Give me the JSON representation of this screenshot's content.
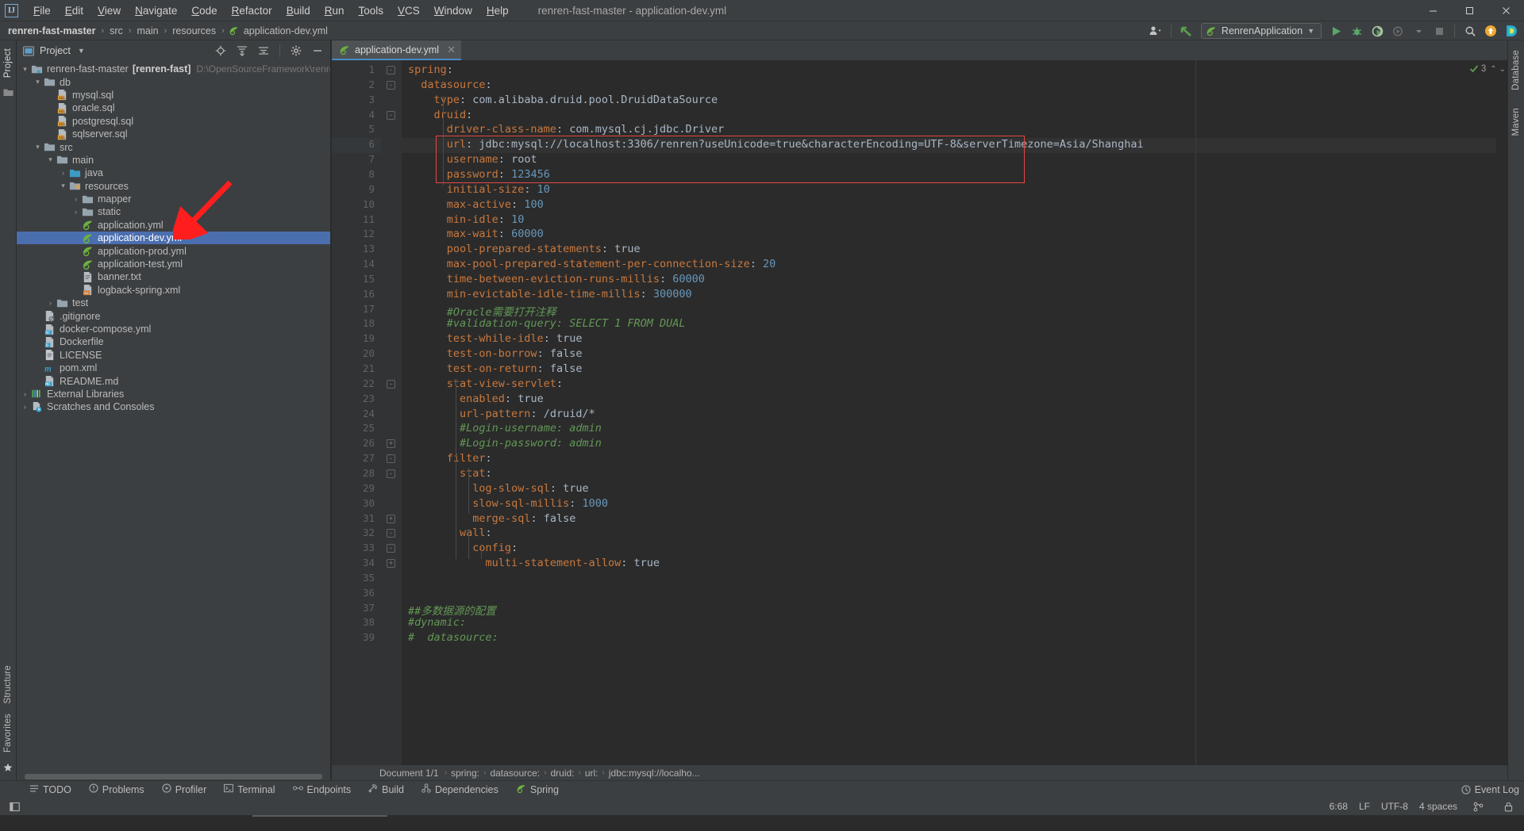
{
  "window": {
    "title": "renren-fast-master - application-dev.yml",
    "logo": "IJ",
    "minimize": "—",
    "maximize": "⬜",
    "close": "✕"
  },
  "menu": {
    "items": [
      "File",
      "Edit",
      "View",
      "Navigate",
      "Code",
      "Refactor",
      "Build",
      "Run",
      "Tools",
      "VCS",
      "Window",
      "Help"
    ]
  },
  "navbar": {
    "crumbs": [
      "renren-fast-master",
      "src",
      "main",
      "resources",
      "application-dev.yml"
    ],
    "separator": "›",
    "run_config": "RenrenApplication",
    "icons": {
      "profile": "profile-icon",
      "updates": "update-arrow-icon",
      "run": "run-icon",
      "debug": "debug-icon",
      "run_coverage": "run-with-coverage-icon",
      "profiler": "profiler-icon",
      "stop": "stop-icon",
      "search": "search-everywhere-icon",
      "notifications": "notification-icon",
      "idea_feature": "idea-feature-icon"
    }
  },
  "left_strip": {
    "project": "Project",
    "structure": "Structure",
    "favorites": "Favorites"
  },
  "right_strip": {
    "database": "Database",
    "maven": "Maven"
  },
  "project_panel": {
    "title": "Project",
    "chevron": "▾",
    "icons": [
      "locate-icon",
      "expand-all-icon",
      "collapse-all-icon",
      "settings-gear-icon",
      "hide-icon"
    ],
    "tree": [
      {
        "depth": 0,
        "arrow": "▾",
        "icon": "module-folder",
        "label": "renren-fast-master",
        "module": "[renren-fast]",
        "path": "D:\\OpenSourceFramework\\renren-fast-m",
        "selected": false
      },
      {
        "depth": 1,
        "arrow": "▾",
        "icon": "folder",
        "label": "db",
        "selected": false
      },
      {
        "depth": 2,
        "arrow": "",
        "icon": "sql-file",
        "label": "mysql.sql",
        "selected": false
      },
      {
        "depth": 2,
        "arrow": "",
        "icon": "sql-file",
        "label": "oracle.sql",
        "selected": false
      },
      {
        "depth": 2,
        "arrow": "",
        "icon": "sql-file",
        "label": "postgresql.sql",
        "selected": false
      },
      {
        "depth": 2,
        "arrow": "",
        "icon": "sql-file",
        "label": "sqlserver.sql",
        "selected": false
      },
      {
        "depth": 1,
        "arrow": "▾",
        "icon": "folder",
        "label": "src",
        "selected": false
      },
      {
        "depth": 2,
        "arrow": "▾",
        "icon": "folder",
        "label": "main",
        "selected": false
      },
      {
        "depth": 3,
        "arrow": "›",
        "icon": "source-folder",
        "label": "java",
        "selected": false
      },
      {
        "depth": 3,
        "arrow": "▾",
        "icon": "resource-folder",
        "label": "resources",
        "selected": false
      },
      {
        "depth": 4,
        "arrow": "›",
        "icon": "folder",
        "label": "mapper",
        "selected": false
      },
      {
        "depth": 4,
        "arrow": "›",
        "icon": "folder",
        "label": "static",
        "selected": false
      },
      {
        "depth": 4,
        "arrow": "",
        "icon": "spring-yaml-file",
        "label": "application.yml",
        "selected": false
      },
      {
        "depth": 4,
        "arrow": "",
        "icon": "spring-yaml-file",
        "label": "application-dev.yml",
        "selected": true
      },
      {
        "depth": 4,
        "arrow": "",
        "icon": "spring-yaml-file",
        "label": "application-prod.yml",
        "selected": false
      },
      {
        "depth": 4,
        "arrow": "",
        "icon": "spring-yaml-file",
        "label": "application-test.yml",
        "selected": false
      },
      {
        "depth": 4,
        "arrow": "",
        "icon": "text-file",
        "label": "banner.txt",
        "selected": false
      },
      {
        "depth": 4,
        "arrow": "",
        "icon": "xml-file",
        "label": "logback-spring.xml",
        "selected": false
      },
      {
        "depth": 2,
        "arrow": "›",
        "icon": "folder",
        "label": "test",
        "selected": false
      },
      {
        "depth": 1,
        "arrow": "",
        "icon": "gitignore-file",
        "label": ".gitignore",
        "selected": false
      },
      {
        "depth": 1,
        "arrow": "",
        "icon": "docker-compose-file",
        "label": "docker-compose.yml",
        "selected": false
      },
      {
        "depth": 1,
        "arrow": "",
        "icon": "docker-file",
        "label": "Dockerfile",
        "selected": false
      },
      {
        "depth": 1,
        "arrow": "",
        "icon": "license-file",
        "label": "LICENSE",
        "selected": false
      },
      {
        "depth": 1,
        "arrow": "",
        "icon": "maven-file",
        "label": "pom.xml",
        "selected": false
      },
      {
        "depth": 1,
        "arrow": "",
        "icon": "markdown-file",
        "label": "README.md",
        "selected": false
      },
      {
        "depth": 0,
        "arrow": "›",
        "icon": "libraries-icon",
        "label": "External Libraries",
        "selected": false
      },
      {
        "depth": 0,
        "arrow": "›",
        "icon": "scratches-icon",
        "label": "Scratches and Consoles",
        "selected": false
      }
    ]
  },
  "editor": {
    "tab": {
      "label": "application-dev.yml",
      "icon": "spring-yaml-file",
      "close": "✕"
    },
    "inspection": {
      "ok_icon": "✓",
      "count": "3",
      "up": "⌃",
      "down": "⌄"
    },
    "lines": [
      {
        "n": 1,
        "indent": 0,
        "fold": "-",
        "spans": [
          {
            "t": "spring",
            "c": "k"
          },
          {
            "t": ":",
            "c": "p"
          }
        ]
      },
      {
        "n": 2,
        "indent": 2,
        "fold": "-",
        "spans": [
          {
            "t": "datasource",
            "c": "k"
          },
          {
            "t": ":",
            "c": "p"
          }
        ]
      },
      {
        "n": 3,
        "indent": 4,
        "fold": "",
        "spans": [
          {
            "t": "type",
            "c": "k"
          },
          {
            "t": ": ",
            "c": "p"
          },
          {
            "t": "com.alibaba.druid.pool.DruidDataSource",
            "c": "v"
          }
        ]
      },
      {
        "n": 4,
        "indent": 4,
        "fold": "-",
        "spans": [
          {
            "t": "druid",
            "c": "k"
          },
          {
            "t": ":",
            "c": "p"
          }
        ]
      },
      {
        "n": 5,
        "indent": 6,
        "fold": "",
        "spans": [
          {
            "t": "driver-class-name",
            "c": "k"
          },
          {
            "t": ": ",
            "c": "p"
          },
          {
            "t": "com.mysql.cj.jdbc.Driver",
            "c": "v"
          }
        ]
      },
      {
        "n": 6,
        "indent": 6,
        "fold": "",
        "spans": [
          {
            "t": "url",
            "c": "k"
          },
          {
            "t": ": ",
            "c": "p"
          },
          {
            "t": "jdbc:mysql://localhost:3306/renren?useUnicode=true&characterEncoding=UTF-8&serverTimezone=Asia/Shanghai",
            "c": "v"
          }
        ]
      },
      {
        "n": 7,
        "indent": 6,
        "fold": "",
        "spans": [
          {
            "t": "username",
            "c": "k"
          },
          {
            "t": ": ",
            "c": "p"
          },
          {
            "t": "root",
            "c": "v"
          }
        ]
      },
      {
        "n": 8,
        "indent": 6,
        "fold": "",
        "spans": [
          {
            "t": "password",
            "c": "k"
          },
          {
            "t": ": ",
            "c": "p"
          },
          {
            "t": "123456",
            "c": "n"
          }
        ]
      },
      {
        "n": 9,
        "indent": 6,
        "fold": "",
        "spans": [
          {
            "t": "initial-size",
            "c": "k"
          },
          {
            "t": ": ",
            "c": "p"
          },
          {
            "t": "10",
            "c": "n"
          }
        ]
      },
      {
        "n": 10,
        "indent": 6,
        "fold": "",
        "spans": [
          {
            "t": "max-active",
            "c": "k"
          },
          {
            "t": ": ",
            "c": "p"
          },
          {
            "t": "100",
            "c": "n"
          }
        ]
      },
      {
        "n": 11,
        "indent": 6,
        "fold": "",
        "spans": [
          {
            "t": "min-idle",
            "c": "k"
          },
          {
            "t": ": ",
            "c": "p"
          },
          {
            "t": "10",
            "c": "n"
          }
        ]
      },
      {
        "n": 12,
        "indent": 6,
        "fold": "",
        "spans": [
          {
            "t": "max-wait",
            "c": "k"
          },
          {
            "t": ": ",
            "c": "p"
          },
          {
            "t": "60000",
            "c": "n"
          }
        ]
      },
      {
        "n": 13,
        "indent": 6,
        "fold": "",
        "spans": [
          {
            "t": "pool-prepared-statements",
            "c": "k"
          },
          {
            "t": ": ",
            "c": "p"
          },
          {
            "t": "true",
            "c": "v"
          }
        ]
      },
      {
        "n": 14,
        "indent": 6,
        "fold": "",
        "spans": [
          {
            "t": "max-pool-prepared-statement-per-connection-size",
            "c": "k"
          },
          {
            "t": ": ",
            "c": "p"
          },
          {
            "t": "20",
            "c": "n"
          }
        ]
      },
      {
        "n": 15,
        "indent": 6,
        "fold": "",
        "spans": [
          {
            "t": "time-between-eviction-runs-millis",
            "c": "k"
          },
          {
            "t": ": ",
            "c": "p"
          },
          {
            "t": "60000",
            "c": "n"
          }
        ]
      },
      {
        "n": 16,
        "indent": 6,
        "fold": "",
        "spans": [
          {
            "t": "min-evictable-idle-time-millis",
            "c": "k"
          },
          {
            "t": ": ",
            "c": "p"
          },
          {
            "t": "300000",
            "c": "n"
          }
        ]
      },
      {
        "n": 17,
        "indent": 6,
        "fold": "",
        "spans": [
          {
            "t": "#Oracle需要打开注释",
            "c": "cmt"
          }
        ]
      },
      {
        "n": 18,
        "indent": 6,
        "fold": "",
        "spans": [
          {
            "t": "#validation-query: SELECT 1 FROM DUAL",
            "c": "cmt"
          }
        ]
      },
      {
        "n": 19,
        "indent": 6,
        "fold": "",
        "spans": [
          {
            "t": "test-while-idle",
            "c": "k"
          },
          {
            "t": ": ",
            "c": "p"
          },
          {
            "t": "true",
            "c": "v"
          }
        ]
      },
      {
        "n": 20,
        "indent": 6,
        "fold": "",
        "spans": [
          {
            "t": "test-on-borrow",
            "c": "k"
          },
          {
            "t": ": ",
            "c": "p"
          },
          {
            "t": "false",
            "c": "v"
          }
        ]
      },
      {
        "n": 21,
        "indent": 6,
        "fold": "",
        "spans": [
          {
            "t": "test-on-return",
            "c": "k"
          },
          {
            "t": ": ",
            "c": "p"
          },
          {
            "t": "false",
            "c": "v"
          }
        ]
      },
      {
        "n": 22,
        "indent": 6,
        "fold": "-",
        "spans": [
          {
            "t": "stat-view-servlet",
            "c": "k"
          },
          {
            "t": ":",
            "c": "p"
          }
        ]
      },
      {
        "n": 23,
        "indent": 8,
        "fold": "",
        "spans": [
          {
            "t": "enabled",
            "c": "k"
          },
          {
            "t": ": ",
            "c": "p"
          },
          {
            "t": "true",
            "c": "v"
          }
        ]
      },
      {
        "n": 24,
        "indent": 8,
        "fold": "",
        "spans": [
          {
            "t": "url-pattern",
            "c": "k"
          },
          {
            "t": ": ",
            "c": "p"
          },
          {
            "t": "/druid/*",
            "c": "v"
          }
        ]
      },
      {
        "n": 25,
        "indent": 8,
        "fold": "",
        "spans": [
          {
            "t": "#Login-username: admin",
            "c": "cmt"
          }
        ]
      },
      {
        "n": 26,
        "indent": 8,
        "fold": "+",
        "spans": [
          {
            "t": "#Login-password: admin",
            "c": "cmt"
          }
        ]
      },
      {
        "n": 27,
        "indent": 6,
        "fold": "-",
        "spans": [
          {
            "t": "filter",
            "c": "k"
          },
          {
            "t": ":",
            "c": "p"
          }
        ]
      },
      {
        "n": 28,
        "indent": 8,
        "fold": "-",
        "spans": [
          {
            "t": "stat",
            "c": "k"
          },
          {
            "t": ":",
            "c": "p"
          }
        ]
      },
      {
        "n": 29,
        "indent": 10,
        "fold": "",
        "spans": [
          {
            "t": "log-slow-sql",
            "c": "k"
          },
          {
            "t": ": ",
            "c": "p"
          },
          {
            "t": "true",
            "c": "v"
          }
        ]
      },
      {
        "n": 30,
        "indent": 10,
        "fold": "",
        "spans": [
          {
            "t": "slow-sql-millis",
            "c": "k"
          },
          {
            "t": ": ",
            "c": "p"
          },
          {
            "t": "1000",
            "c": "n"
          }
        ]
      },
      {
        "n": 31,
        "indent": 10,
        "fold": "+",
        "spans": [
          {
            "t": "merge-sql",
            "c": "k"
          },
          {
            "t": ": ",
            "c": "p"
          },
          {
            "t": "false",
            "c": "v"
          }
        ]
      },
      {
        "n": 32,
        "indent": 8,
        "fold": "-",
        "spans": [
          {
            "t": "wall",
            "c": "k"
          },
          {
            "t": ":",
            "c": "p"
          }
        ]
      },
      {
        "n": 33,
        "indent": 10,
        "fold": "-",
        "spans": [
          {
            "t": "config",
            "c": "k"
          },
          {
            "t": ":",
            "c": "p"
          }
        ]
      },
      {
        "n": 34,
        "indent": 12,
        "fold": "+",
        "spans": [
          {
            "t": "multi-statement-allow",
            "c": "k"
          },
          {
            "t": ": ",
            "c": "p"
          },
          {
            "t": "true",
            "c": "v"
          }
        ]
      },
      {
        "n": 35,
        "indent": 0,
        "fold": "",
        "spans": []
      },
      {
        "n": 36,
        "indent": 0,
        "fold": "",
        "spans": []
      },
      {
        "n": 37,
        "indent": 0,
        "fold": "",
        "spans": [
          {
            "t": "##多数据源的配置",
            "c": "cmt"
          }
        ]
      },
      {
        "n": 38,
        "indent": 0,
        "fold": "",
        "spans": [
          {
            "t": "#dynamic:",
            "c": "cmt"
          }
        ]
      },
      {
        "n": 39,
        "indent": 0,
        "fold": "",
        "spans": [
          {
            "t": "#  datasource:",
            "c": "cmt"
          }
        ]
      }
    ],
    "breadcrumb": {
      "document": "Document 1/1",
      "path": [
        "spring:",
        "datasource:",
        "druid:",
        "url:",
        "jdbc:mysql://localho..."
      ],
      "separator": "›"
    }
  },
  "bottom_tools": [
    {
      "label": "TODO",
      "icon": "todo-icon"
    },
    {
      "label": "Problems",
      "icon": "problems-icon"
    },
    {
      "label": "Profiler",
      "icon": "profiler-icon"
    },
    {
      "label": "Terminal",
      "icon": "terminal-icon"
    },
    {
      "label": "Endpoints",
      "icon": "endpoints-icon"
    },
    {
      "label": "Build",
      "icon": "build-icon"
    },
    {
      "label": "Dependencies",
      "icon": "dependencies-icon"
    },
    {
      "label": "Spring",
      "icon": "spring-icon"
    }
  ],
  "bottom_right": {
    "event_log": "Event Log",
    "event_icon": "event-log-icon"
  },
  "statusbar": {
    "caret": "6:68",
    "line_sep": "LF",
    "encoding": "UTF-8",
    "indent": "4 spaces",
    "lock_icon": "lock-icon",
    "branch_icon": "branch-icon",
    "left_icon": "show-hide-icon"
  },
  "annotations": {
    "highlight_box_color": "#e24a42",
    "arrow_color": "#ff0000",
    "arrow_label": "red-arrow-pointing-to-application-dev-yml"
  },
  "colors": {
    "background": "#3c3f41",
    "editor_background": "#2b2b2b",
    "gutter": "#313335",
    "selection": "#4b6eaf",
    "key": "#c9783d",
    "number": "#6897bb",
    "comment": "#629755",
    "text": "#a9b7c6"
  }
}
